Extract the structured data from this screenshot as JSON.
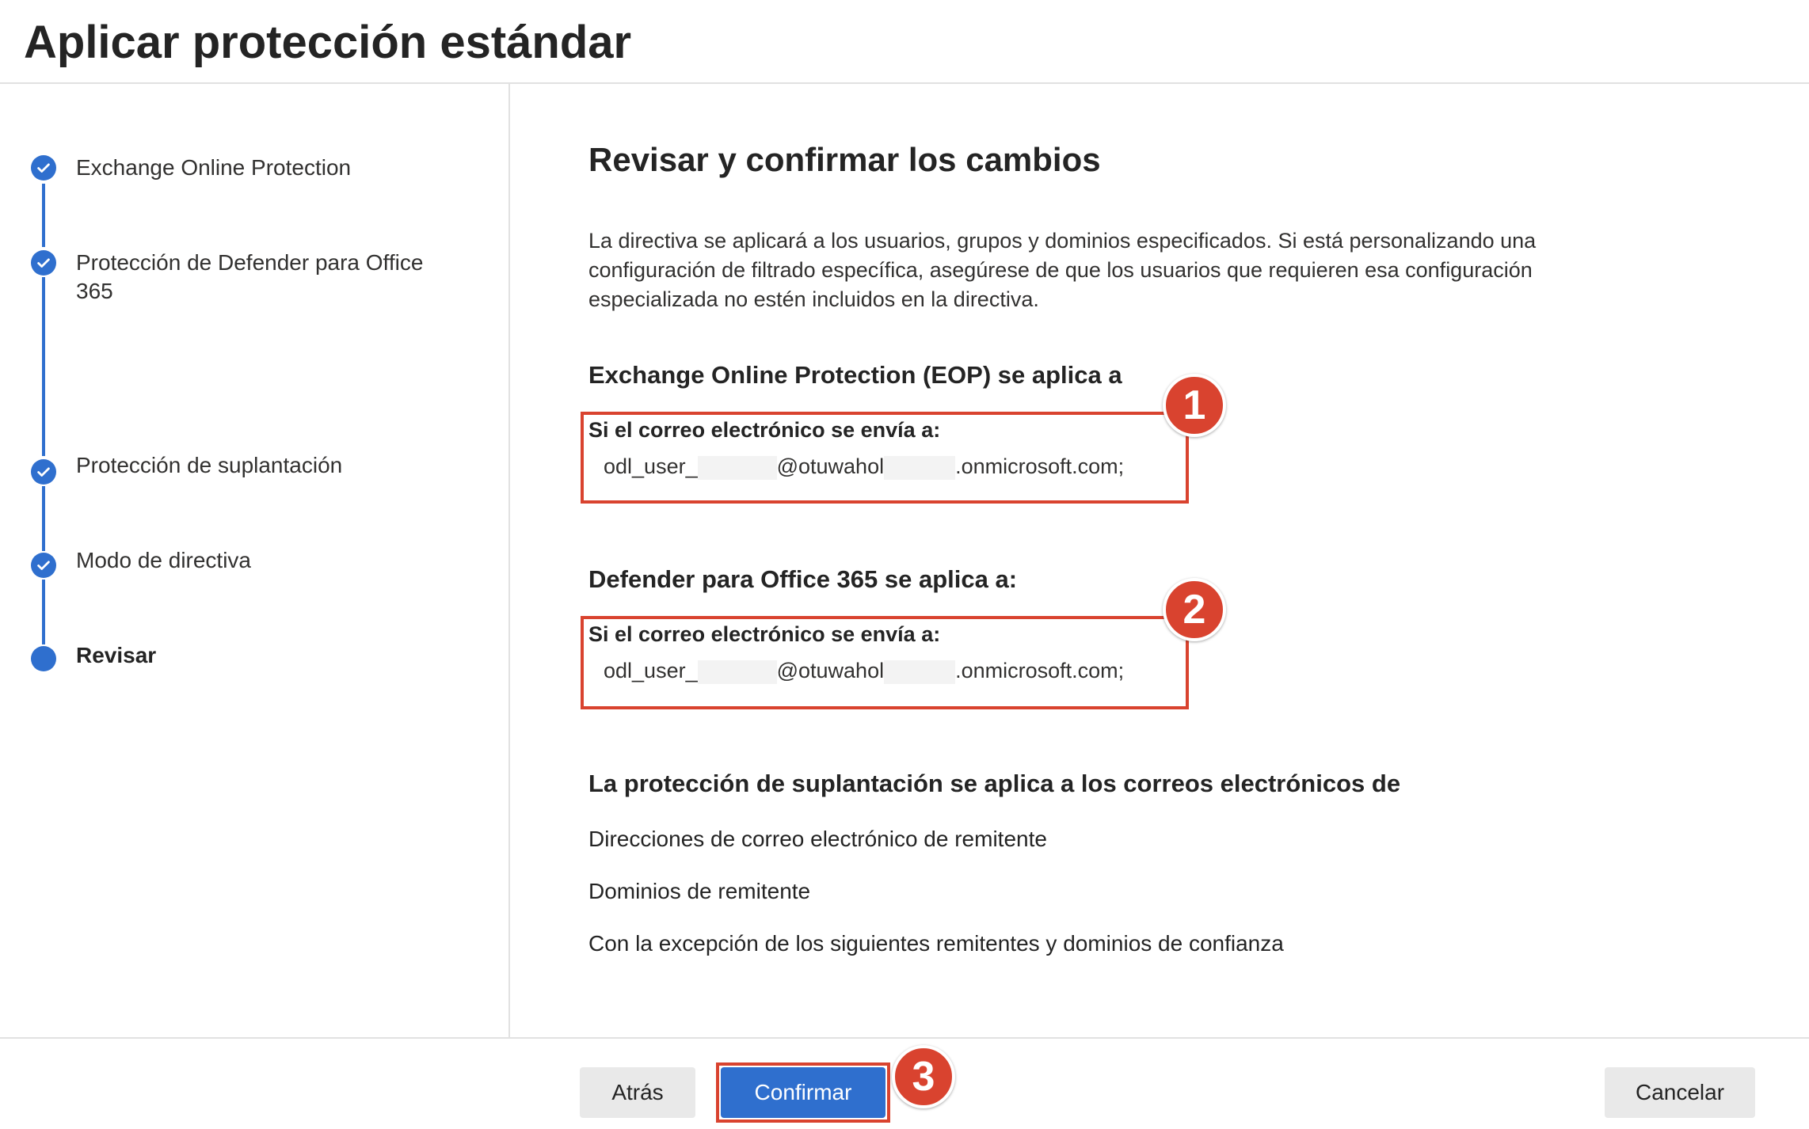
{
  "header": {
    "title": "Aplicar protección estándar"
  },
  "sidebar": {
    "steps": [
      {
        "label": "Exchange Online Protection",
        "state": "completed"
      },
      {
        "label": "Protección de Defender para Office 365",
        "state": "completed"
      },
      {
        "label": "Protección de suplantación",
        "state": "completed"
      },
      {
        "label": "Modo de directiva",
        "state": "completed"
      },
      {
        "label": "Revisar",
        "state": "current"
      }
    ]
  },
  "main": {
    "title": "Revisar y confirmar los cambios",
    "description": "La directiva se aplicará a los usuarios, grupos y dominios especificados. Si está personalizando una configuración de filtrado específica, asegúrese de que los usuarios que requieren esa configuración especializada no estén incluidos en la directiva.",
    "eop": {
      "heading": "Exchange Online Protection (EOP) se aplica a",
      "condition": "Si el correo electrónico se envía a:",
      "email_prefix": "odl_user_",
      "email_middle": "@otuwahol",
      "email_suffix": ".onmicrosoft.com;",
      "badge": "1"
    },
    "defender": {
      "heading": "Defender para Office 365 se aplica a:",
      "condition": "Si el correo electrónico se envía a:",
      "email_prefix": "odl_user_",
      "email_middle": "@otuwahol",
      "email_suffix": ".onmicrosoft.com;",
      "badge": "2"
    },
    "impersonation": {
      "heading": "La protección de suplantación se aplica a los correos electrónicos de",
      "items": [
        "Direcciones de correo electrónico de remitente",
        "Dominios de remitente",
        "Con la excepción de los siguientes remitentes y dominios de confianza"
      ]
    }
  },
  "footer": {
    "back_label": "Atrás",
    "confirm_label": "Confirmar",
    "confirm_badge": "3",
    "cancel_label": "Cancelar"
  },
  "colors": {
    "accent": "#2f6fce",
    "annotation": "#d9432f",
    "divider": "#e1e1e1"
  }
}
